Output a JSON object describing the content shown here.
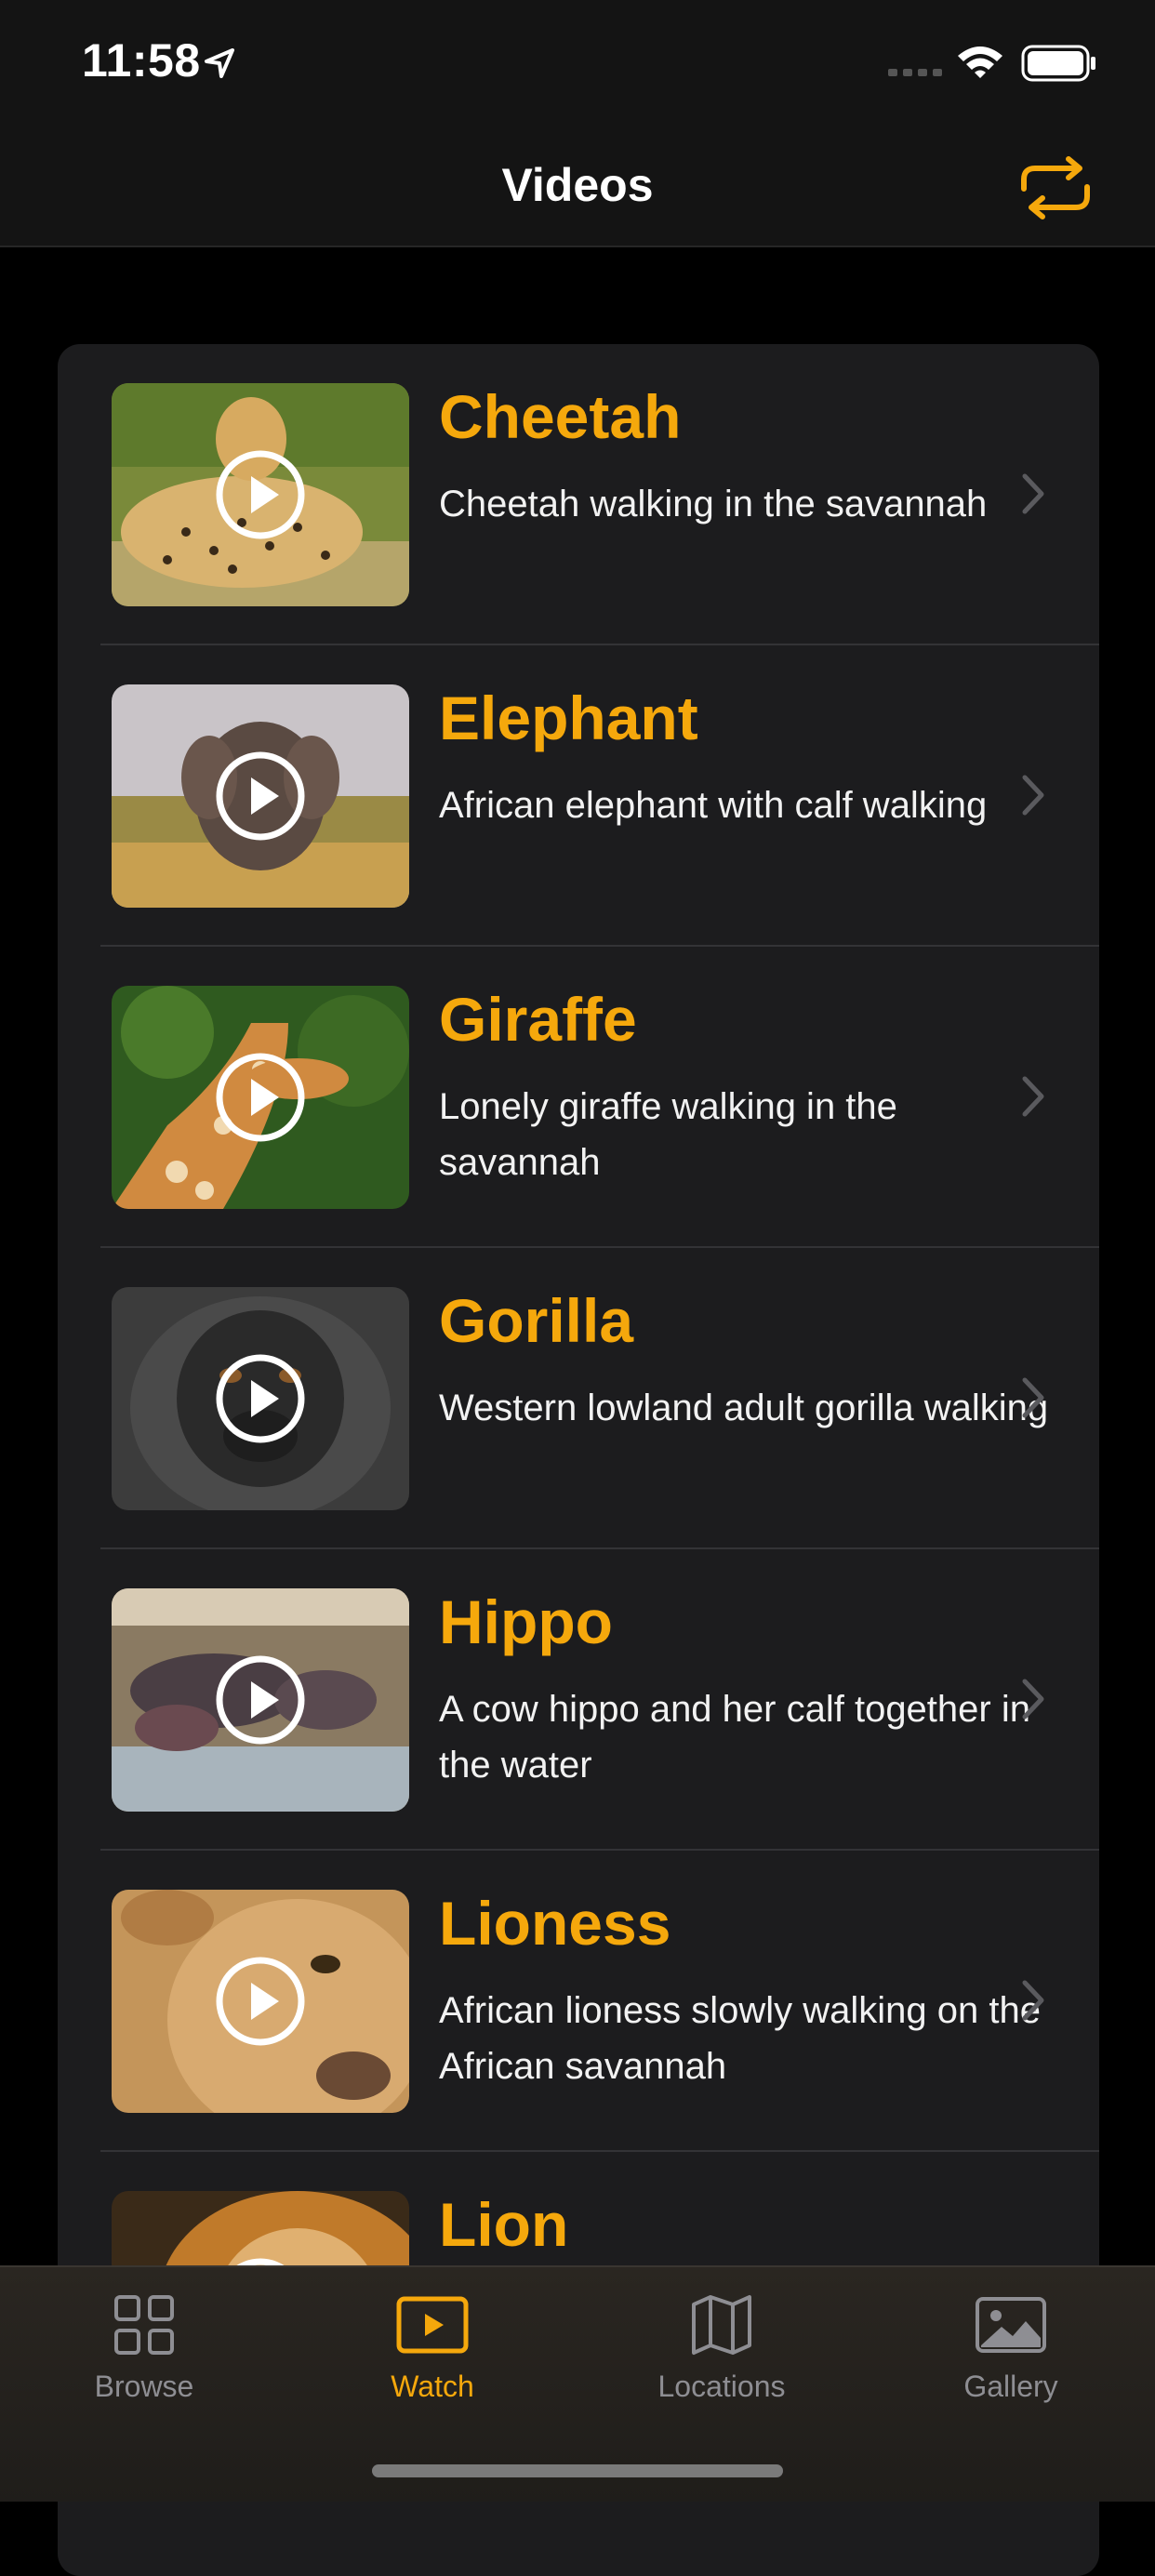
{
  "status_bar": {
    "time": "11:58"
  },
  "nav": {
    "title": "Videos"
  },
  "videos": [
    {
      "title": "Cheetah",
      "description": "Cheetah walking in the savannah"
    },
    {
      "title": "Elephant",
      "description": "African elephant with calf walking"
    },
    {
      "title": "Giraffe",
      "description": "Lonely giraffe walking in the savannah"
    },
    {
      "title": "Gorilla",
      "description": "Western lowland adult gorilla walking"
    },
    {
      "title": "Hippo",
      "description": "A cow hippo and her calf together in the water"
    },
    {
      "title": "Lioness",
      "description": "African lioness slowly walking on the African savannah"
    },
    {
      "title": "Lion",
      "description": ""
    }
  ],
  "tabs": [
    {
      "label": "Browse",
      "icon": "grid-icon"
    },
    {
      "label": "Watch",
      "icon": "play-rectangle-icon",
      "active": true
    },
    {
      "label": "Locations",
      "icon": "map-icon"
    },
    {
      "label": "Gallery",
      "icon": "photo-icon"
    }
  ],
  "colors": {
    "accent": "#f5a80c",
    "background": "#000000",
    "card": "#1c1c1e"
  }
}
